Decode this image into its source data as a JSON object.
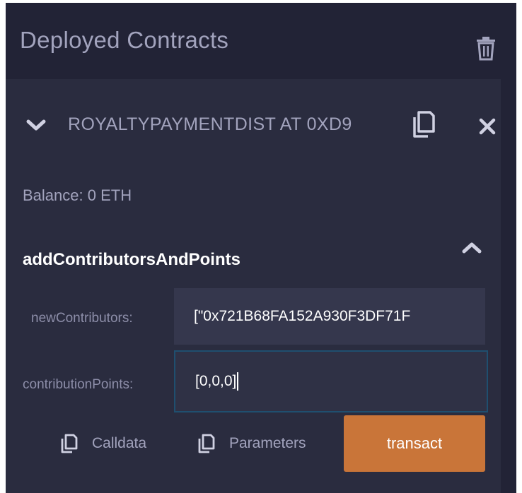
{
  "header": {
    "title": "Deployed Contracts",
    "trash_icon": "trash-icon"
  },
  "contract": {
    "name": "ROYALTYPAYMENTDIST AT 0XD9",
    "expand_icon": "chevron-down-icon",
    "copy_icon": "copy-icon",
    "close_icon": "close-icon",
    "balance": "Balance: 0 ETH"
  },
  "function": {
    "name": "addContributorsAndPoints",
    "collapse_icon": "chevron-up-icon",
    "params": [
      {
        "label": "newContributors:",
        "value": "[\"0x721B68FA152A930F3DF71F"
      },
      {
        "label": "contributionPoints:",
        "value": "[0,0,0]"
      }
    ],
    "calldata_label": "Calldata",
    "parameters_label": "Parameters",
    "transact_label": "transact"
  },
  "colors": {
    "background": "#222336",
    "card": "#2a2c3f",
    "input": "#35374d",
    "accent": "#c97539",
    "text_muted": "#a2a3bd",
    "active_border": "#1f4f6f"
  }
}
